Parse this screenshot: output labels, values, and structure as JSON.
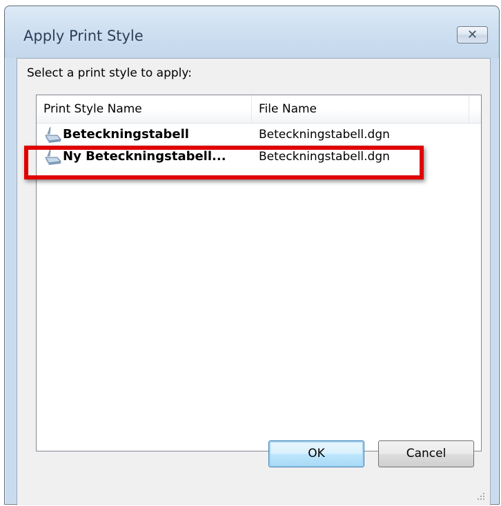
{
  "dialog": {
    "title": "Apply Print Style",
    "close_glyph": "✕",
    "prompt": "Select a print style to apply:"
  },
  "list": {
    "columns": [
      "Print Style Name",
      "File Name"
    ],
    "rows": [
      {
        "name": "Beteckningstabell",
        "file": "Beteckningstabell.dgn",
        "icon": "print-style-icon"
      },
      {
        "name": "Ny Beteckningstabell...",
        "file": "Beteckningstabell.dgn",
        "icon": "print-style-icon"
      }
    ],
    "highlighted_row": 1
  },
  "buttons": {
    "ok": "OK",
    "cancel": "Cancel"
  },
  "colors": {
    "highlight": "#e00000",
    "titlebar": "#cfe0f1"
  }
}
